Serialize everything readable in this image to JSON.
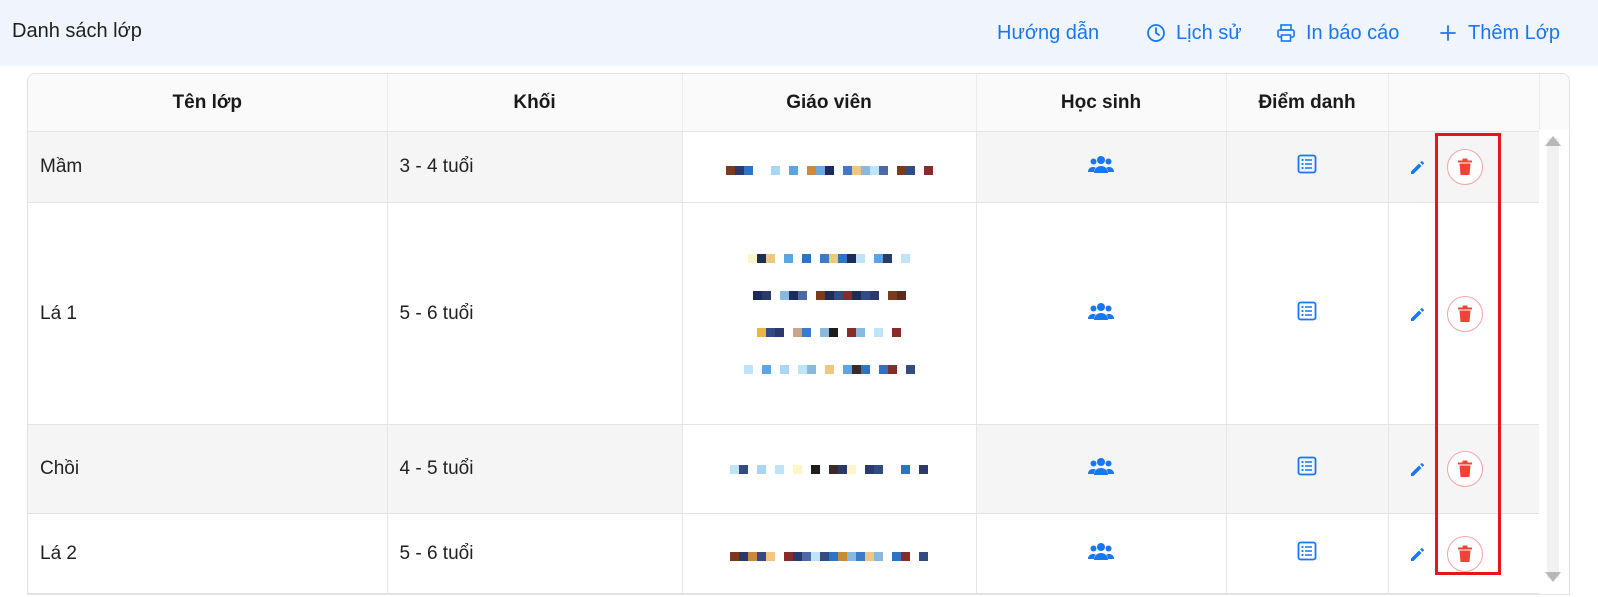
{
  "header": {
    "title": "Danh sách lớp",
    "actions": {
      "guide": "Hướng dẫn",
      "history": "Lịch sử",
      "print": "In báo cáo",
      "add": "Thêm Lớp"
    }
  },
  "table": {
    "columns": {
      "name": "Tên lớp",
      "grade": "Khối",
      "teacher": "Giáo viên",
      "students": "Học sinh",
      "attendance": "Điểm danh"
    },
    "rows": [
      {
        "name": "Mầm",
        "grade": "3 - 4 tuổi"
      },
      {
        "name": "Lá 1",
        "grade": "5 - 6 tuổi"
      },
      {
        "name": "Chồi",
        "grade": "4 - 5 tuổi"
      },
      {
        "name": "Lá 2",
        "grade": "5 - 6 tuổi"
      }
    ]
  },
  "icons": {
    "history": "clock-icon",
    "print": "printer-icon",
    "add": "plus-icon",
    "students": "users-icon",
    "attendance": "list-icon",
    "edit": "pencil-icon",
    "delete": "trash-icon"
  },
  "colors": {
    "accent": "#1877f2",
    "danger": "#f44336",
    "highlight": "#e8141b",
    "topbar": "#f0f5fd"
  }
}
